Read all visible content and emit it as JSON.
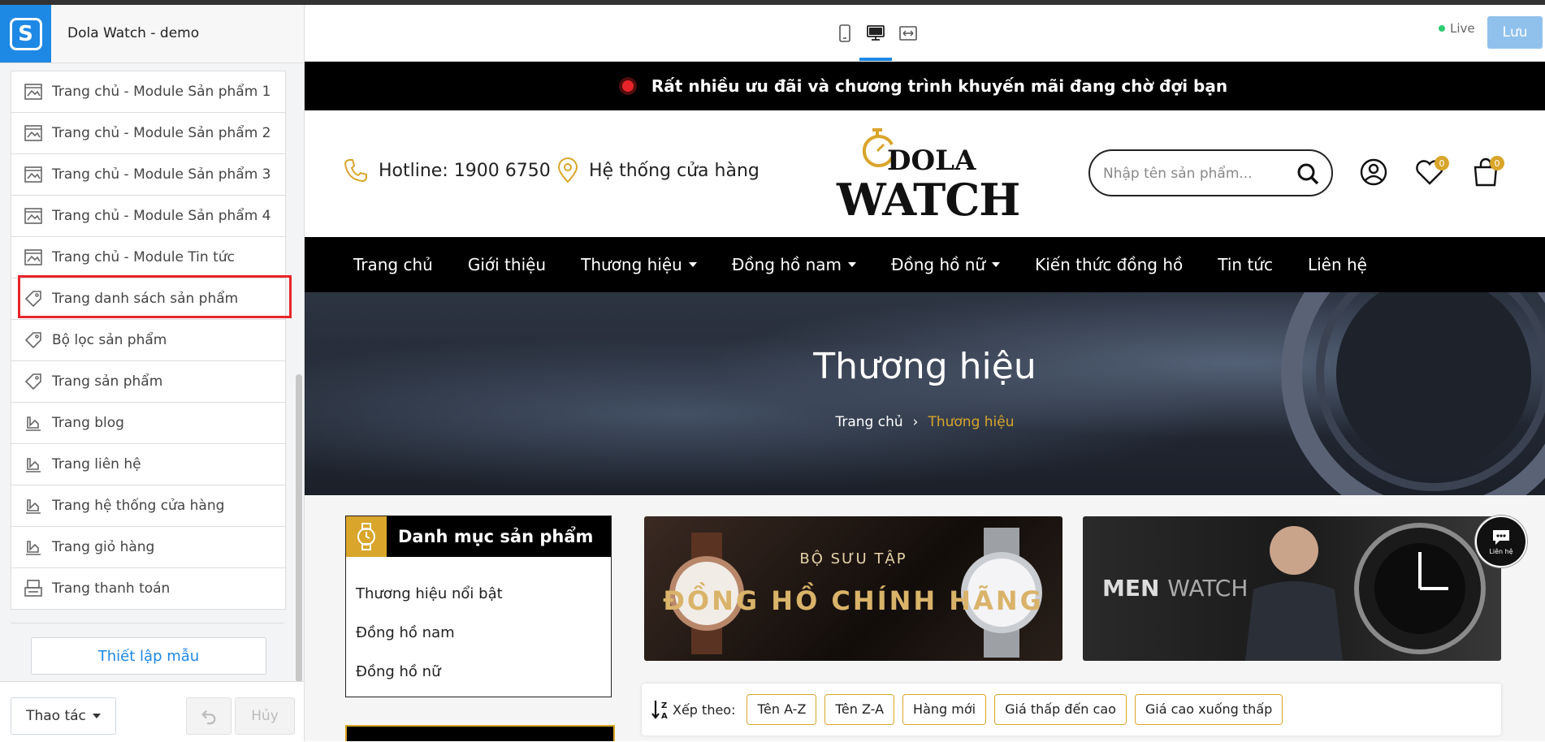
{
  "editor": {
    "store_title": "Dola Watch - demo",
    "templates": [
      {
        "label": "Trang chủ - Module Sản phẩm 1",
        "icon": "layout-icon"
      },
      {
        "label": "Trang chủ - Module Sản phẩm 2",
        "icon": "layout-icon"
      },
      {
        "label": "Trang chủ - Module Sản phẩm 3",
        "icon": "layout-icon"
      },
      {
        "label": "Trang chủ - Module Sản phẩm 4",
        "icon": "layout-icon"
      },
      {
        "label": "Trang chủ - Module Tin tức",
        "icon": "layout-icon"
      },
      {
        "label": "Trang danh sách sản phẩm",
        "icon": "tag-icon",
        "highlighted": true
      },
      {
        "label": "Bộ lọc sản phẩm",
        "icon": "tag-icon"
      },
      {
        "label": "Trang sản phẩm",
        "icon": "tag-icon"
      },
      {
        "label": "Trang blog",
        "icon": "page-edit-icon"
      },
      {
        "label": "Trang liên hệ",
        "icon": "page-edit-icon"
      },
      {
        "label": "Trang hệ thống cửa hàng",
        "icon": "page-edit-icon"
      },
      {
        "label": "Trang giỏ hàng",
        "icon": "page-edit-icon"
      },
      {
        "label": "Trang thanh toán",
        "icon": "checkout-icon"
      }
    ],
    "setup_label": "Thiết lập mẫu",
    "actions_label": "Thao tác",
    "cancel_label": "Hủy",
    "live_label": "Live",
    "save_label": "Lưu",
    "accent": "#1e88e5"
  },
  "site": {
    "promo": "Rất nhiều ưu đãi và chương trình khuyến mãi đang chờ đợi bạn",
    "hotline": "Hotline: 1900 6750",
    "store_system": "Hệ thống cửa hàng",
    "brand_line1": "DOLA",
    "brand_line2": "WATCH",
    "search_placeholder": "Nhập tên sản phẩm...",
    "wishlist_count": "0",
    "cart_count": "0",
    "nav": [
      {
        "label": "Trang chủ",
        "dropdown": false
      },
      {
        "label": "Giới thiệu",
        "dropdown": false
      },
      {
        "label": "Thương hiệu",
        "dropdown": true
      },
      {
        "label": "Đồng hồ nam",
        "dropdown": true
      },
      {
        "label": "Đồng hồ nữ",
        "dropdown": true
      },
      {
        "label": "Kiến thức đồng hồ",
        "dropdown": false
      },
      {
        "label": "Tin tức",
        "dropdown": false
      },
      {
        "label": "Liên hệ",
        "dropdown": false
      }
    ],
    "hero_title": "Thương hiệu",
    "breadcrumb": [
      "Trang chủ",
      "Thương hiệu"
    ],
    "breadcrumb_sep": "›",
    "category": {
      "title": "Danh mục sản phẩm",
      "items": [
        "Thương hiệu nổi bật",
        "Đồng hồ nam",
        "Đồng hồ nữ"
      ]
    },
    "banner1": {
      "small": "BỘ SƯU TẬP",
      "big": "ĐỒNG HỒ CHÍNH HÃNG"
    },
    "banner2": {
      "bold": "MEN",
      "light": "WATCH"
    },
    "chat_label": "Liên hệ",
    "sort": {
      "label": "Xếp theo:",
      "options": [
        "Tên A-Z",
        "Tên Z-A",
        "Hàng mới",
        "Giá thấp đến cao",
        "Giá cao xuống thấp"
      ]
    },
    "gold": "#d9a52a"
  }
}
